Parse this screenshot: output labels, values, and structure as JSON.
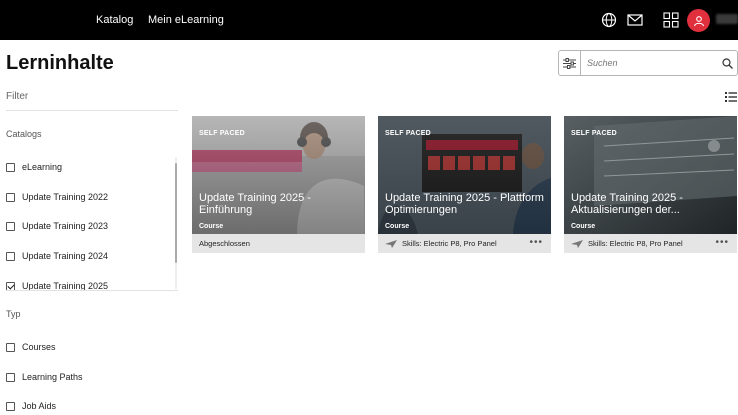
{
  "topbar": {
    "nav": [
      "Katalog",
      "Mein eLearning"
    ],
    "icons": [
      "globe-icon",
      "mail-icon",
      "apps-grid-icon",
      "user-avatar-icon"
    ],
    "accent": "#e0303d"
  },
  "page": {
    "title": "Lerninhalte"
  },
  "search": {
    "placeholder": "Suchen"
  },
  "sidebar": {
    "filter_heading": "Filter",
    "catalogs_label": "Catalogs",
    "catalogs": [
      {
        "label": "eLearning",
        "checked": false
      },
      {
        "label": "Update Training 2022",
        "checked": false
      },
      {
        "label": "Update Training 2023",
        "checked": false
      },
      {
        "label": "Update Training 2024",
        "checked": false
      },
      {
        "label": "Update Training 2025",
        "checked": true
      }
    ],
    "type_label": "Typ",
    "types": [
      {
        "label": "Courses",
        "checked": false
      },
      {
        "label": "Learning Paths",
        "checked": false
      },
      {
        "label": "Job Aids",
        "checked": false
      }
    ]
  },
  "cards": [
    {
      "badge": "SELF PACED",
      "title": "Update Training 2025 - Einführung",
      "type": "Course",
      "footer": "Abgeschlossen"
    },
    {
      "badge": "SELF PACED",
      "title": "Update Training 2025 - Plattform Optimierungen",
      "type": "Course",
      "footer": "Skills:  Electric P8, Pro Panel",
      "more": "•••"
    },
    {
      "badge": "SELF PACED",
      "title": "Update Training 2025 - Aktualisierungen der...",
      "type": "Course",
      "footer": "Skills:  Electric P8, Pro Panel",
      "more": "•••"
    }
  ]
}
